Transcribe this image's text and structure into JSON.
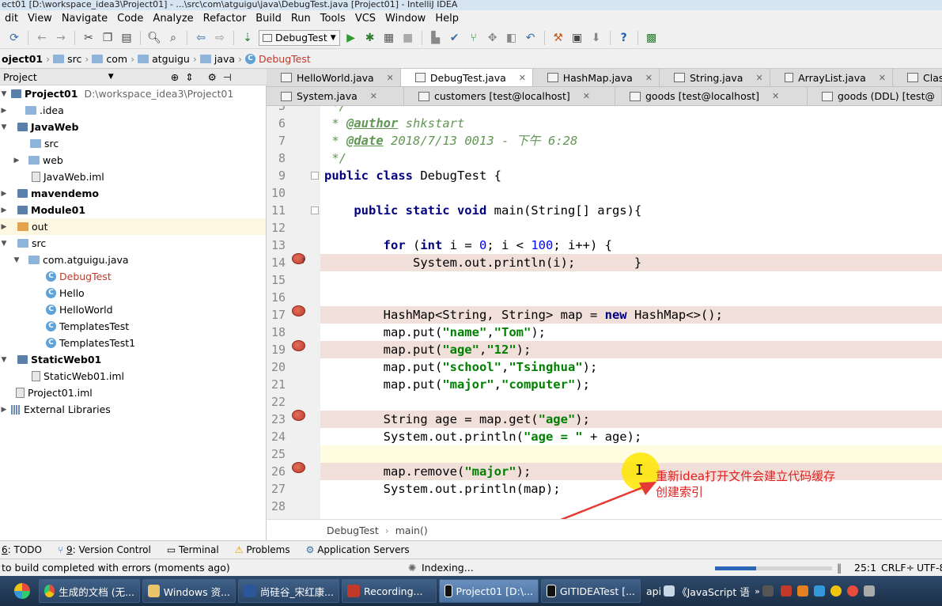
{
  "window": {
    "title": "ect01 [D:\\workspace_idea3\\Project01] - ...\\src\\com\\atguigu\\java\\DebugTest.java [Project01] - IntelliJ IDEA"
  },
  "menu": [
    "dit",
    "View",
    "Navigate",
    "Code",
    "Analyze",
    "Refactor",
    "Build",
    "Run",
    "Tools",
    "VCS",
    "Window",
    "Help"
  ],
  "toolbar": {
    "run_config": "DebugTest"
  },
  "breadcrumbs": [
    "oject01",
    "src",
    "com",
    "atguigu",
    "java",
    "DebugTest"
  ],
  "project_panel": {
    "title": "Project",
    "tree": [
      {
        "label": "Project01",
        "extra": "D:\\workspace_idea3\\Project01",
        "bold": true
      },
      {
        "label": ".idea"
      },
      {
        "label": "JavaWeb",
        "bold": true
      },
      {
        "label": "src"
      },
      {
        "label": "web"
      },
      {
        "label": "JavaWeb.iml"
      },
      {
        "label": "mavendemo",
        "bold": true
      },
      {
        "label": "Module01",
        "bold": true
      },
      {
        "label": "out"
      },
      {
        "label": "src"
      },
      {
        "label": "com.atguigu.java"
      },
      {
        "label": "DebugTest"
      },
      {
        "label": "Hello"
      },
      {
        "label": "HelloWorld"
      },
      {
        "label": "TemplatesTest"
      },
      {
        "label": "TemplatesTest1"
      },
      {
        "label": "StaticWeb01",
        "bold": true
      },
      {
        "label": "StaticWeb01.iml"
      },
      {
        "label": "Project01.iml"
      },
      {
        "label": "External Libraries"
      }
    ]
  },
  "editor_tabs_row1": [
    "HelloWorld.java",
    "DebugTest.java",
    "HashMap.java",
    "String.java",
    "ArrayList.java",
    "Clas"
  ],
  "editor_tabs_row2": [
    "System.java",
    "customers [test@localhost]",
    "goods [test@localhost]",
    "goods (DDL) [test@"
  ],
  "code": {
    "line_numbers": [
      "5",
      "6",
      "7",
      "8",
      "9",
      "10",
      "11",
      "12",
      "13",
      "14",
      "15",
      "16",
      "17",
      "18",
      "19",
      "20",
      "21",
      "22",
      "23",
      "24",
      "25",
      "26",
      "27",
      "28"
    ],
    "author_line": " * @author shkstart",
    "date_line": " * @date 2018/7/13 0013 - 下午 6:28",
    "author_tag": "@author",
    "author_val": "shkstart",
    "date_tag": "@date",
    "date_val": "2018/7/13 0013 - 下午 6:28"
  },
  "editor_breadcrumb": [
    "DebugTest",
    "main()"
  ],
  "tool_windows": [
    {
      "key": "6",
      "label": ": TODO"
    },
    {
      "key": "9",
      "label": ": Version Control"
    },
    {
      "key": "",
      "label": "Terminal"
    },
    {
      "key": "",
      "label": "Problems"
    },
    {
      "key": "",
      "label": "Application Servers"
    }
  ],
  "status": {
    "message": "to build completed with errors (moments ago)",
    "indexing": "Indexing...",
    "indexing_progress": 0.35,
    "position": "25:1",
    "line_sep": "CRLF÷",
    "encoding": "UTF-8"
  },
  "annotation": {
    "line1": "重新idea打开文件会建立代码缓存",
    "line2": "创建索引"
  },
  "taskbar": [
    "生成的文档 (无...",
    "Windows 资...",
    "尚硅谷_宋红康...",
    "Recording...",
    "Project01 [D:\\...",
    "GITIDEATest [...",
    "api",
    "《JavaScript 语"
  ]
}
